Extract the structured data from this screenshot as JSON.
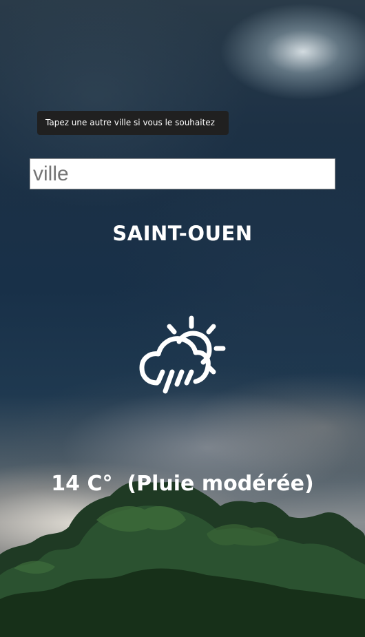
{
  "tooltip": {
    "text": "Tapez une autre ville si vous le souhaitez"
  },
  "search": {
    "placeholder": "ville",
    "value": ""
  },
  "location": {
    "city": "SAINT-OUEN"
  },
  "weather": {
    "icon": "sun-cloud-rain-icon",
    "temperature": "14",
    "unit": "C°",
    "condition": "(Pluie modérée)"
  },
  "colors": {
    "text": "#ffffff",
    "tooltip_bg": "#202020",
    "input_bg": "#ffffff"
  }
}
